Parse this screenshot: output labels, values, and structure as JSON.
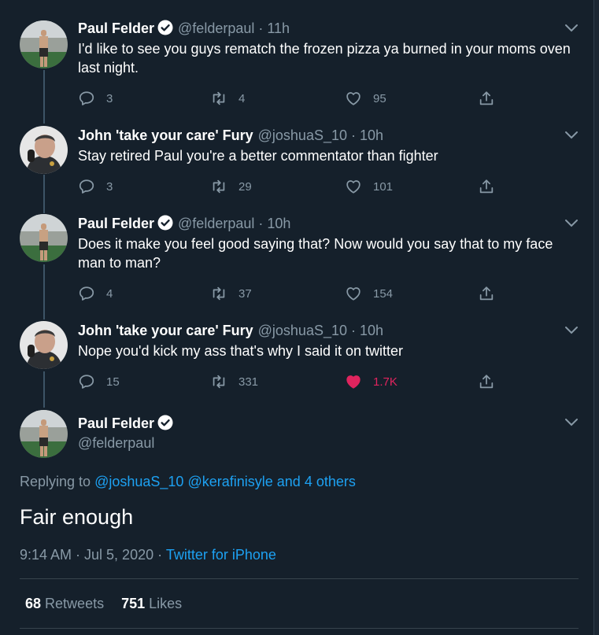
{
  "tweets": [
    {
      "name": "Paul Felder",
      "verified": true,
      "handle": "@felderpaul",
      "time": "11h",
      "text": "I'd like to see you guys rematch the frozen pizza ya burned in your moms oven last night.",
      "replies": "3",
      "retweets": "4",
      "likes": "95",
      "liked": false
    },
    {
      "name": "John 'take your care' Fury",
      "verified": false,
      "handle": "@joshuaS_10",
      "time": "10h",
      "text": "Stay retired Paul you're a better commentator than fighter",
      "replies": "3",
      "retweets": "29",
      "likes": "101",
      "liked": false
    },
    {
      "name": "Paul Felder",
      "verified": true,
      "handle": "@felderpaul",
      "time": "10h",
      "text": "Does it make you feel good saying that? Now would you say that to my face man to man?",
      "replies": "4",
      "retweets": "37",
      "likes": "154",
      "liked": false
    },
    {
      "name": "John 'take your care' Fury",
      "verified": false,
      "handle": "@joshuaS_10",
      "time": "10h",
      "text": "Nope you'd kick my ass that's why I said it on twitter",
      "replies": "15",
      "retweets": "331",
      "likes": "1.7K",
      "liked": true
    }
  ],
  "main": {
    "name": "Paul Felder",
    "handle": "@felderpaul",
    "replying_prefix": "Replying to",
    "replying_users": [
      "@joshuaS_10",
      "@kerafinisyle"
    ],
    "replying_and": "and",
    "replying_others": "4 others",
    "text": "Fair enough",
    "timestamp": "9:14 AM · Jul 5, 2020",
    "meta_sep": "·",
    "source": "Twitter for iPhone",
    "retweets_count": "68",
    "retweets_label": "Retweets",
    "likes_count": "751",
    "likes_label": "Likes"
  },
  "colors": {
    "background": "#15202b",
    "text_primary": "#ffffff",
    "text_secondary": "#8899a6",
    "link": "#1da1f2",
    "like_active": "#e0245e",
    "separator": "#38444d"
  },
  "icons": [
    "verified-badge-icon",
    "chevron-down-icon",
    "reply-icon",
    "retweet-icon",
    "heart-icon",
    "share-icon"
  ]
}
